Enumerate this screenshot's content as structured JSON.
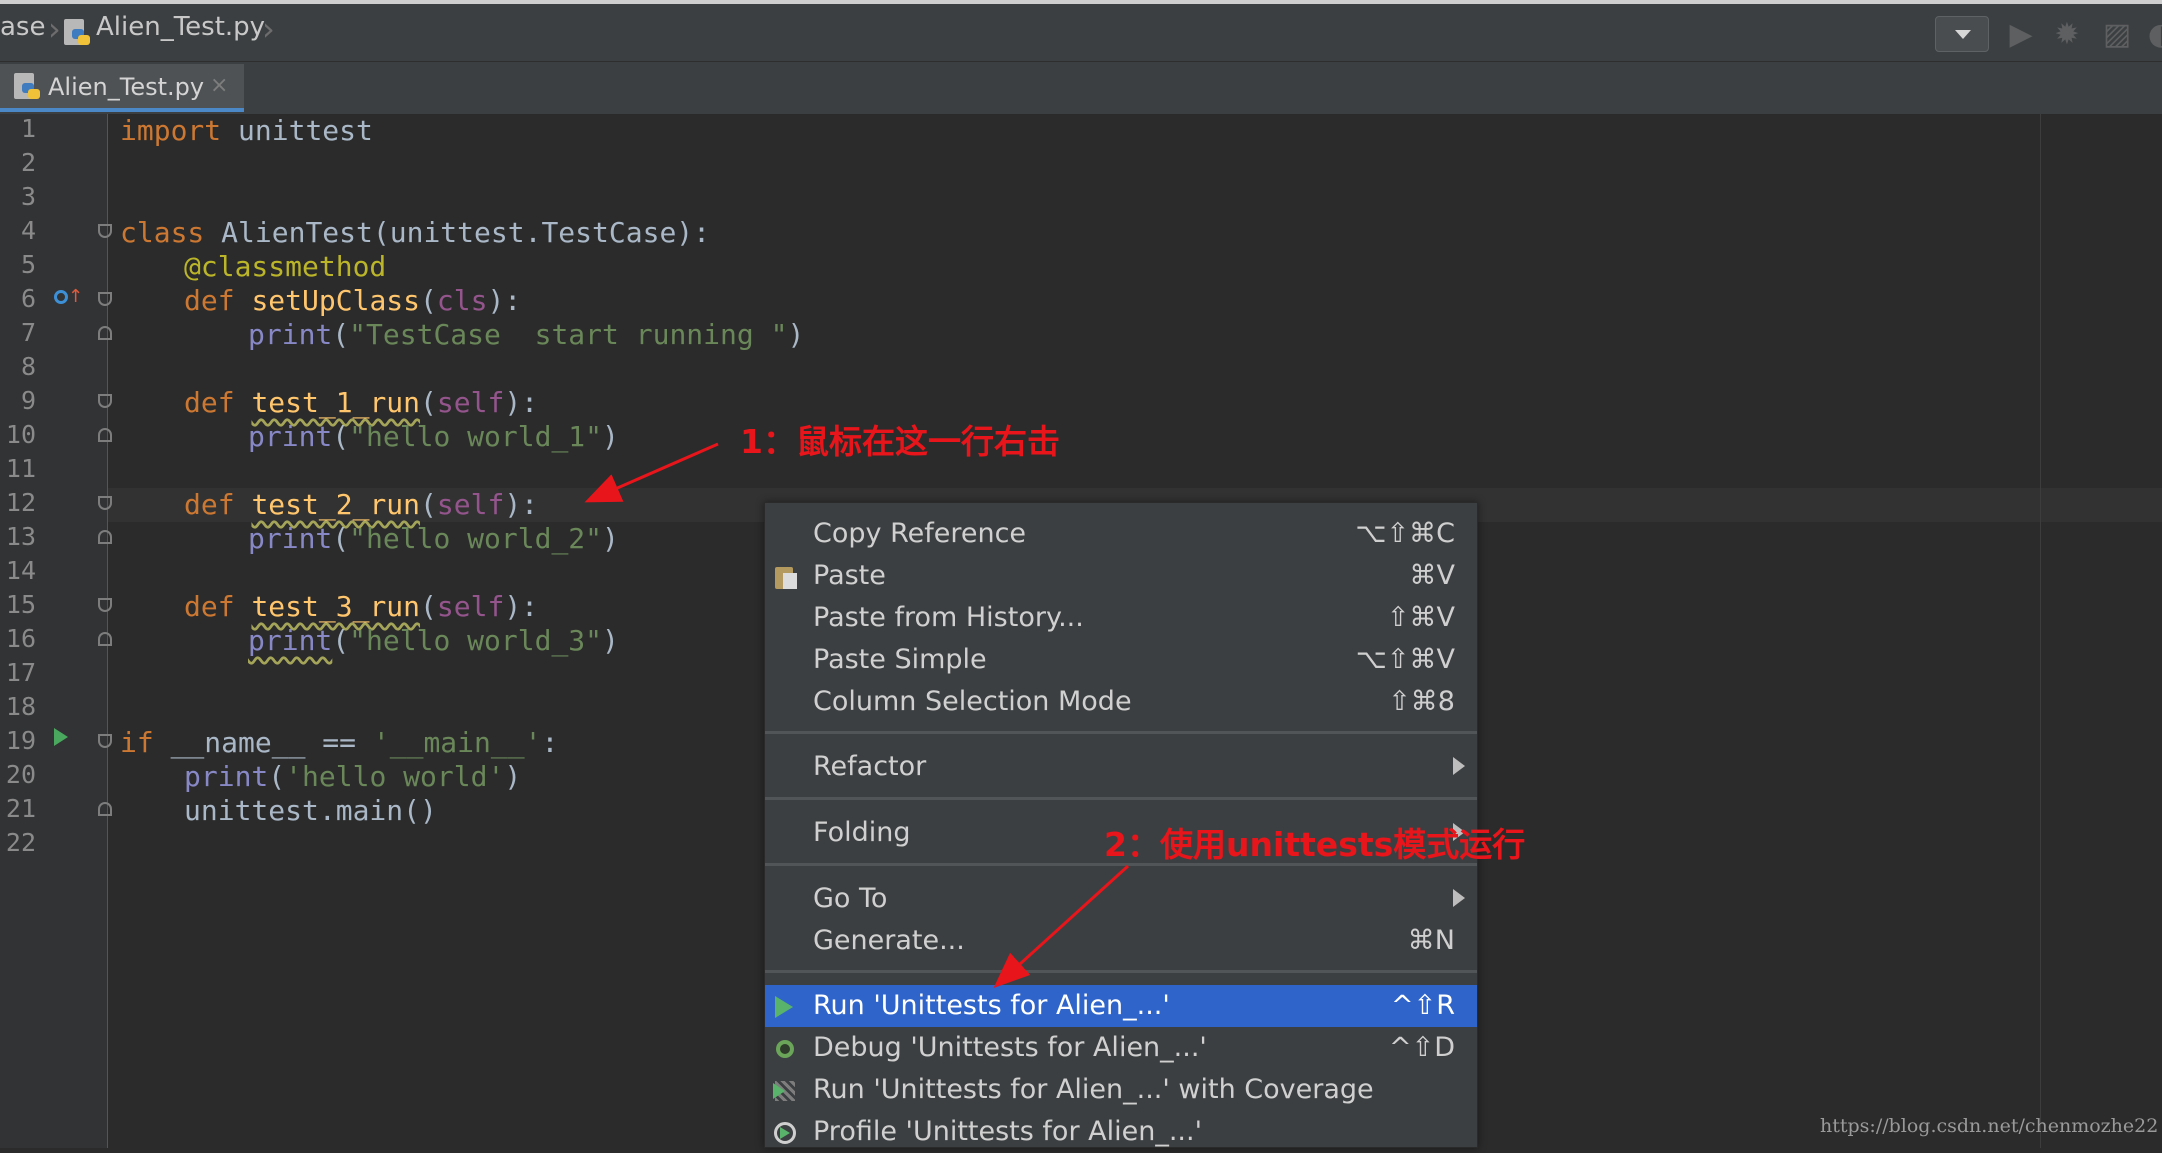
{
  "navbar": {
    "breadcrumb_partial": "ase",
    "file_name": "Alien_Test.py"
  },
  "tabs": [
    {
      "label": "Alien_Test.py",
      "close": "×"
    }
  ],
  "editor": {
    "line_numbers": [
      "1",
      "2",
      "3",
      "4",
      "5",
      "6",
      "7",
      "8",
      "9",
      "10",
      "11",
      "12",
      "13",
      "14",
      "15",
      "16",
      "17",
      "18",
      "19",
      "20",
      "21",
      "22"
    ],
    "code": {
      "l1_kw": "import",
      "l1_rest": " unittest",
      "l4_kw": "class",
      "l4_rest": " AlienTest(unittest.TestCase):",
      "l5_dec": "@classmethod",
      "l6_kw": "def",
      "l6_fn": "setUpClass",
      "l6_p1": "(",
      "l6_param": "cls",
      "l6_p2": "):",
      "l7_bi": "print",
      "l7_p1": "(",
      "l7_str": "\"TestCase  start running \"",
      "l7_p2": ")",
      "l9_kw": "def",
      "l9_fn": "test_1_run",
      "l9_p1": "(",
      "l9_param": "self",
      "l9_p2": "):",
      "l10_bi": "print",
      "l10_p1": "(",
      "l10_str": "\"hello world_1\"",
      "l10_p2": ")",
      "l12_kw": "def",
      "l12_fn": "test_2_run",
      "l12_p1": "(",
      "l12_param": "self",
      "l12_p2": "):",
      "l13_bi": "print",
      "l13_p1": "(",
      "l13_str": "\"hello world_2\"",
      "l13_p2": ")",
      "l15_kw": "def",
      "l15_fn": "test_3_run",
      "l15_p1": "(",
      "l15_param": "self",
      "l15_p2": "):",
      "l16_bi": "print",
      "l16_p1": "(",
      "l16_str": "\"hello world_3\"",
      "l16_p2": ")",
      "l19_kw": "if",
      "l19_mid": " __name__ == ",
      "l19_str": "'__main__'",
      "l19_end": ":",
      "l20_bi": "print",
      "l20_p1": "(",
      "l20_str": "'hello world'",
      "l20_p2": ")",
      "l21_rest": "unittest.main()"
    }
  },
  "context_menu": {
    "items": [
      {
        "label": "Copy Reference",
        "shortcut": "⌥⇧⌘C"
      },
      {
        "label": "Paste",
        "shortcut": "⌘V",
        "icon": "clipboard-icon"
      },
      {
        "label": "Paste from History...",
        "shortcut": "⇧⌘V"
      },
      {
        "label": "Paste Simple",
        "shortcut": "⌥⇧⌘V"
      },
      {
        "label": "Column Selection Mode",
        "shortcut": "⇧⌘8"
      },
      {
        "label": "Refactor",
        "submenu": true
      },
      {
        "label": "Folding",
        "submenu": true
      },
      {
        "label": "Go To",
        "submenu": true
      },
      {
        "label": "Generate...",
        "shortcut": "⌘N"
      },
      {
        "label": "Run 'Unittests for Alien_...'",
        "shortcut": "^⇧R",
        "icon": "run-icon",
        "selected": true
      },
      {
        "label": "Debug 'Unittests for Alien_...'",
        "shortcut": "^⇧D",
        "icon": "debug-icon"
      },
      {
        "label": "Run 'Unittests for Alien_...' with Coverage",
        "icon": "coverage-icon"
      },
      {
        "label": "Profile 'Unittests for Alien_...'",
        "icon": "profile-icon"
      }
    ]
  },
  "annotations": {
    "step1": "1：鼠标在这一行右击",
    "step2": "2：使用unittests模式运行",
    "color": "#e8151b"
  },
  "watermark": "https://blog.csdn.net/chenmozhe22",
  "colors": {
    "background": "#2b2b2b",
    "keyword": "#cc7832",
    "function": "#ffc66d",
    "string": "#6a8759",
    "builtin": "#8888c6",
    "self_param": "#94558d",
    "decorator": "#bbb529",
    "menu_selected": "#2f65ca"
  }
}
